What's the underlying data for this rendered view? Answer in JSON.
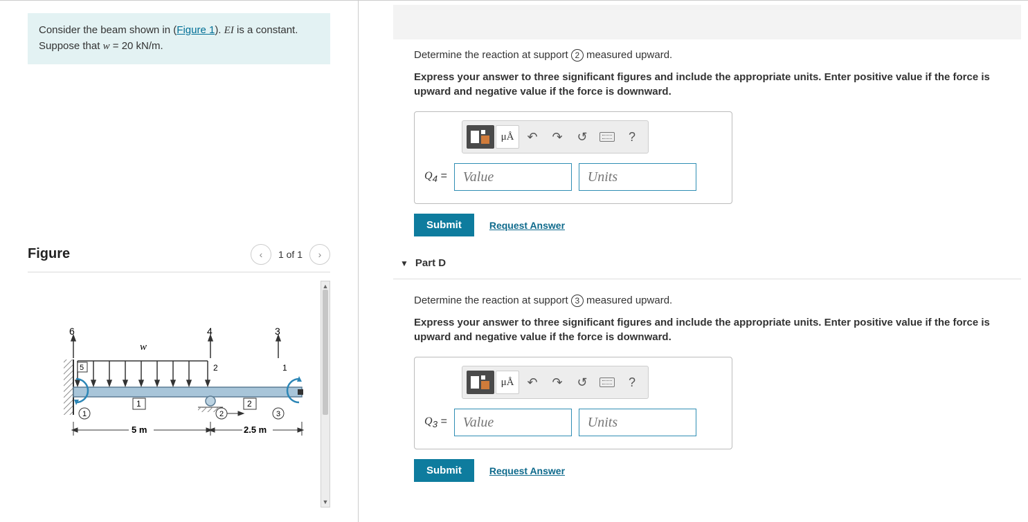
{
  "problem": {
    "text_pre": "Consider the beam shown in (",
    "figure_link": "Figure 1",
    "text_mid": "). ",
    "ei_text": "EI",
    "text_post": " is a constant. Suppose that ",
    "w_var": "w",
    "w_eq": " = 20 kN/m."
  },
  "figure": {
    "title": "Figure",
    "counter": "1 of 1",
    "labels": {
      "load": "w",
      "node6": "6",
      "node5": "5",
      "node4": "4",
      "node3": "3",
      "node2_top": "2",
      "node1_top": "1",
      "span1": "1",
      "span2": "2",
      "support1": "1",
      "support2": "2",
      "support3": "3",
      "dim1": "5 m",
      "dim2": "2.5 m"
    }
  },
  "parts": {
    "c": {
      "question_pre": "Determine the reaction at support ",
      "support_num": "2",
      "question_post": " measured upward.",
      "instruction": "Express your answer to three significant figures and include the appropriate units. Enter positive value if the force is upward and negative value if the force is downward.",
      "label": "Q",
      "label_sub": "4",
      "label_eq": " = ",
      "value_placeholder": "Value",
      "units_placeholder": "Units",
      "submit": "Submit",
      "request": "Request Answer"
    },
    "d": {
      "title": "Part D",
      "question_pre": "Determine the reaction at support ",
      "support_num": "3",
      "question_post": " measured upward.",
      "instruction": "Express your answer to three significant figures and include the appropriate units. Enter positive value if the force is upward and negative value if the force is downward.",
      "label": "Q",
      "label_sub": "3",
      "label_eq": " = ",
      "value_placeholder": "Value",
      "units_placeholder": "Units",
      "submit": "Submit",
      "request": "Request Answer"
    }
  },
  "toolbar": {
    "mu_a": "μÅ",
    "help": "?"
  }
}
